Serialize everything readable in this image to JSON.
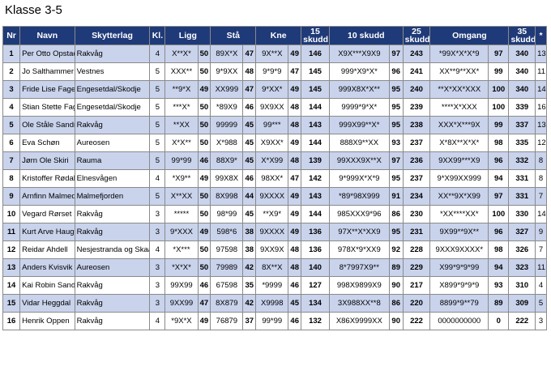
{
  "page": {
    "title": "Klasse 3-5"
  },
  "table": {
    "headers": {
      "nr": "Nr",
      "navn": "Navn",
      "skytterlag": "Skytterlag",
      "kl": "Kl.",
      "ligg": "Ligg",
      "sta": "Stå",
      "kne": "Kne",
      "skudd15_line1": "15",
      "skudd15_line2": "skudd",
      "skudd10": "10 skudd",
      "skudd25_line1": "25",
      "skudd25_line2": "skudd",
      "omgang": "Omgang",
      "skudd35_line1": "35",
      "skudd35_line2": "skudd",
      "star": "*"
    },
    "rows": [
      {
        "nr": "1",
        "name": "Per Otto Opstad",
        "club": "Rakvåg",
        "kl": "4",
        "ligg": "X**X*",
        "ligg_p": "50",
        "sta": "89X*X",
        "sta_p": "47",
        "kne": "9X**X",
        "kne_p": "49",
        "s15": "146",
        "s10": "X9X***X9X9",
        "s10_p": "97",
        "s25": "243",
        "omg": "*99X*X*X*9",
        "omg_p": "97",
        "s35": "340",
        "star": "13"
      },
      {
        "nr": "2",
        "name": "Jo Salthammer",
        "club": "Vestnes",
        "kl": "5",
        "ligg": "XXX**",
        "ligg_p": "50",
        "sta": "9*9XX",
        "sta_p": "48",
        "kne": "9*9*9",
        "kne_p": "47",
        "s15": "145",
        "s10": "999*X9*X*",
        "s10_p": "96",
        "s25": "241",
        "omg": "XX**9**XX*",
        "omg_p": "99",
        "s35": "340",
        "star": "11"
      },
      {
        "nr": "3",
        "name": "Fride Lise Fagervoll",
        "club": "Engesetdal/Skodje",
        "kl": "5",
        "ligg": "**9*X",
        "ligg_p": "49",
        "sta": "XX999",
        "sta_p": "47",
        "kne": "9*XX*",
        "kne_p": "49",
        "s15": "145",
        "s10": "999X8X*X**",
        "s10_p": "95",
        "s25": "240",
        "omg": "**X*XX*XXX",
        "omg_p": "100",
        "s35": "340",
        "star": "14"
      },
      {
        "nr": "4",
        "name": "Stian Stette Fagervoll",
        "club": "Engesetdal/Skodje",
        "kl": "5",
        "ligg": "***X*",
        "ligg_p": "50",
        "sta": "*89X9",
        "sta_p": "46",
        "kne": "9X9XX",
        "kne_p": "48",
        "s15": "144",
        "s10": "9999*9*X*",
        "s10_p": "95",
        "s25": "239",
        "omg": "****X*XXX",
        "omg_p": "100",
        "s35": "339",
        "star": "16"
      },
      {
        "nr": "5",
        "name": "Ole Ståle Sandnes",
        "club": "Rakvåg",
        "kl": "5",
        "ligg": "**XX",
        "ligg_p": "50",
        "sta": "99999",
        "sta_p": "45",
        "kne": "99***",
        "kne_p": "48",
        "s15": "143",
        "s10": "999X99**X*",
        "s10_p": "95",
        "s25": "238",
        "omg": "XXX*X***9X",
        "omg_p": "99",
        "s35": "337",
        "star": "13"
      },
      {
        "nr": "6",
        "name": "Eva Schøn",
        "club": "Aureosen",
        "kl": "5",
        "ligg": "X*X**",
        "ligg_p": "50",
        "sta": "X*988",
        "sta_p": "45",
        "kne": "X9XX*",
        "kne_p": "49",
        "s15": "144",
        "s10": "888X9**XX",
        "s10_p": "93",
        "s25": "237",
        "omg": "X*8X**X*X*",
        "omg_p": "98",
        "s35": "335",
        "star": "12"
      },
      {
        "nr": "7",
        "name": "Jørn Ole Skiri",
        "club": "Rauma",
        "kl": "5",
        "ligg": "99*99",
        "ligg_p": "46",
        "sta": "88X9*",
        "sta_p": "45",
        "kne": "X*X99",
        "kne_p": "48",
        "s15": "139",
        "s10": "99XXX9X**X",
        "s10_p": "97",
        "s25": "236",
        "omg": "9XX99***X9",
        "omg_p": "96",
        "s35": "332",
        "star": "8"
      },
      {
        "nr": "8",
        "name": "Kristoffer Rødal",
        "club": "Elnesvågen",
        "kl": "4",
        "ligg": "*X9**",
        "ligg_p": "49",
        "sta": "99X8X",
        "sta_p": "46",
        "kne": "98XX*",
        "kne_p": "47",
        "s15": "142",
        "s10": "9*999X*X*9",
        "s10_p": "95",
        "s25": "237",
        "omg": "9*X99XX999",
        "omg_p": "94",
        "s35": "331",
        "star": "8"
      },
      {
        "nr": "9",
        "name": "Arnfinn Malmedal",
        "club": "Malmefjorden",
        "kl": "5",
        "ligg": "X**XX",
        "ligg_p": "50",
        "sta": "8X998",
        "sta_p": "44",
        "kne": "9XXXX",
        "kne_p": "49",
        "s15": "143",
        "s10": "*89*98X999",
        "s10_p": "91",
        "s25": "234",
        "omg": "XX**9X*X99",
        "omg_p": "97",
        "s35": "331",
        "star": "7"
      },
      {
        "nr": "10",
        "name": "Vegard Rørset",
        "club": "Rakvåg",
        "kl": "3",
        "ligg": "*****",
        "ligg_p": "50",
        "sta": "98*99",
        "sta_p": "45",
        "kne": "**X9*",
        "kne_p": "49",
        "s15": "144",
        "s10": "985XXX9*96",
        "s10_p": "86",
        "s25": "230",
        "omg": "*XX****XX*",
        "omg_p": "100",
        "s35": "330",
        "star": "14"
      },
      {
        "nr": "11",
        "name": "Kurt Arve Haugen",
        "club": "Rakvåg",
        "kl": "3",
        "ligg": "9*XXX",
        "ligg_p": "49",
        "sta": "598*6",
        "sta_p": "38",
        "kne": "9XXXX",
        "kne_p": "49",
        "s15": "136",
        "s10": "97X**X*XX9",
        "s10_p": "95",
        "s25": "231",
        "omg": "9X99**9X**",
        "omg_p": "96",
        "s35": "327",
        "star": "9"
      },
      {
        "nr": "12",
        "name": "Reidar Ahdell",
        "club": "Nesjestranda og Skaala",
        "kl": "4",
        "ligg": "*X***",
        "ligg_p": "50",
        "sta": "97598",
        "sta_p": "38",
        "kne": "9XX9X",
        "kne_p": "48",
        "s15": "136",
        "s10": "978X*9*XX9",
        "s10_p": "92",
        "s25": "228",
        "omg": "9XXX9XXXX*",
        "omg_p": "98",
        "s35": "326",
        "star": "7"
      },
      {
        "nr": "13",
        "name": "Anders Kvisvik",
        "club": "Aureosen",
        "kl": "3",
        "ligg": "*X*X*",
        "ligg_p": "50",
        "sta": "79989",
        "sta_p": "42",
        "kne": "8X**X",
        "kne_p": "48",
        "s15": "140",
        "s10": "8*7997X9**",
        "s10_p": "89",
        "s25": "229",
        "omg": "X99*9*9*99",
        "omg_p": "94",
        "s35": "323",
        "star": "11"
      },
      {
        "nr": "14",
        "name": "Kai Robin Sandnes",
        "club": "Rakvåg",
        "kl": "3",
        "ligg": "99X99",
        "ligg_p": "46",
        "sta": "67598",
        "sta_p": "35",
        "kne": "*9999",
        "kne_p": "46",
        "s15": "127",
        "s10": "998X9899X9",
        "s10_p": "90",
        "s25": "217",
        "omg": "X899*9*9*9",
        "omg_p": "93",
        "s35": "310",
        "star": "4"
      },
      {
        "nr": "15",
        "name": "Vidar Heggdal",
        "club": "Rakvåg",
        "kl": "3",
        "ligg": "9XX99",
        "ligg_p": "47",
        "sta": "8X879",
        "sta_p": "42",
        "kne": "X9998",
        "kne_p": "45",
        "s15": "134",
        "s10": "3X988XX**8",
        "s10_p": "86",
        "s25": "220",
        "omg": "8899*9**79",
        "omg_p": "89",
        "s35": "309",
        "star": "5"
      },
      {
        "nr": "16",
        "name": "Henrik Oppen",
        "club": "Rakvåg",
        "kl": "4",
        "ligg": "*9X*X",
        "ligg_p": "49",
        "sta": "76879",
        "sta_p": "37",
        "kne": "99*99",
        "kne_p": "46",
        "s15": "132",
        "s10": "X86X9999XX",
        "s10_p": "90",
        "s25": "222",
        "omg": "0000000000",
        "omg_p": "0",
        "s35": "222",
        "star": "3"
      }
    ]
  }
}
